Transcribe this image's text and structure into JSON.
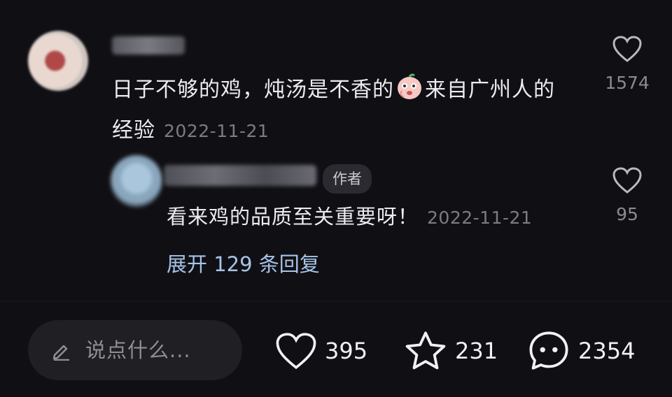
{
  "comment": {
    "text_before_emoji": "日子不够的鸡，炖汤是不香的",
    "emoji_icon": "face-emoji-icon",
    "text_after_emoji": "来自广州人的经验",
    "date": "2022-11-21",
    "like_count": "1574"
  },
  "reply": {
    "author_badge": "作者",
    "text": "看来鸡的品质至关重要呀！",
    "date": "2022-11-21",
    "like_count": "95"
  },
  "expand_replies_label": "展开 129 条回复",
  "bottom_bar": {
    "input_placeholder": "说点什么...",
    "likes": "395",
    "favorites": "231",
    "comments": "2354"
  },
  "colors": {
    "background": "#101014",
    "link": "#a7c3e8",
    "muted": "#7b7b82"
  }
}
